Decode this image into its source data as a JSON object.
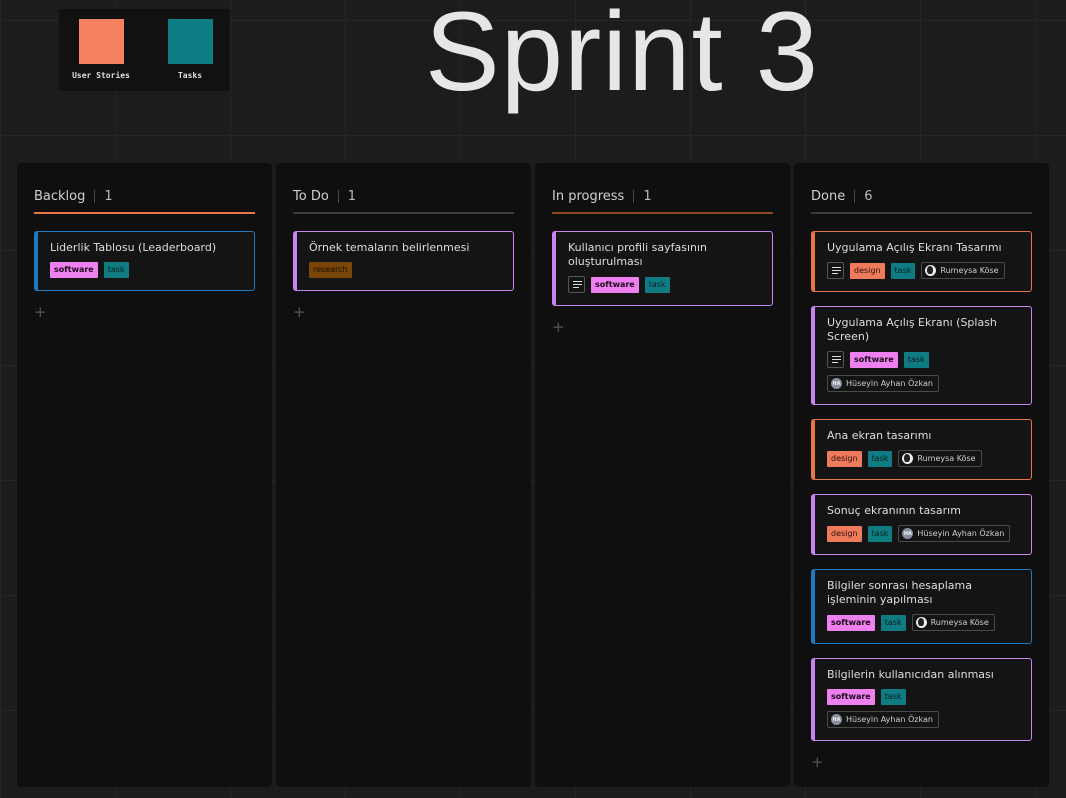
{
  "legend": [
    {
      "label": "User Stories",
      "color": "#f58160"
    },
    {
      "label": "Tasks",
      "color": "#0e7c83"
    }
  ],
  "title": "Sprint 3",
  "colors": {
    "software": "#ef80ef",
    "task": "#0f7b82",
    "design": "#f07a5c",
    "research": "#7a4508",
    "blue": "#1d7ac2",
    "purple": "#c685f0",
    "orange": "#e8744a"
  },
  "columns": [
    {
      "name": "Backlog",
      "count": "1",
      "rule_color": "#e8744a",
      "cards": [
        {
          "title": "Liderlik Tablosu (Leaderboard)",
          "border": "#1d7ac2",
          "note": false,
          "tags": [
            {
              "label": "software",
              "kind": "software"
            },
            {
              "label": "task",
              "kind": "task"
            }
          ],
          "assignee": null
        }
      ]
    },
    {
      "name": "To Do",
      "count": "1",
      "rule_color": "#3c3c3c",
      "cards": [
        {
          "title": "Örnek temaların belirlenmesi",
          "border": "#c685f0",
          "note": false,
          "tags": [
            {
              "label": "research",
              "kind": "research"
            }
          ],
          "assignee": null
        }
      ]
    },
    {
      "name": "In progress",
      "count": "1",
      "rule_color": "#8a4a1e",
      "cards": [
        {
          "title": "Kullanıcı profili sayfasının oluşturulması",
          "border": "#c685f0",
          "note": true,
          "tags": [
            {
              "label": "software",
              "kind": "software"
            },
            {
              "label": "task",
              "kind": "task"
            }
          ],
          "assignee": null
        }
      ]
    },
    {
      "name": "Done",
      "count": "6",
      "rule_color": "#3c3c3c",
      "cards": [
        {
          "title": "Uygulama Açılış Ekranı Tasarımı",
          "border": "#e8744a",
          "note": true,
          "tags": [
            {
              "label": "design",
              "kind": "design"
            },
            {
              "label": "task",
              "kind": "task"
            }
          ],
          "assignee": {
            "name": "Rumeysa Köse",
            "avatar": "r"
          },
          "wrap_assignee": false
        },
        {
          "title": "Uygulama Açılış Ekranı (Splash Screen)",
          "border": "#c685f0",
          "note": true,
          "tags": [
            {
              "label": "software",
              "kind": "software"
            },
            {
              "label": "task",
              "kind": "task"
            }
          ],
          "assignee": {
            "name": "Hüseyin Ayhan Özkan",
            "avatar": "h"
          },
          "wrap_assignee": true
        },
        {
          "title": "Ana ekran tasarımı",
          "border": "#e8744a",
          "note": false,
          "tags": [
            {
              "label": "design",
              "kind": "design"
            },
            {
              "label": "task",
              "kind": "task"
            }
          ],
          "assignee": {
            "name": "Rumeysa Köse",
            "avatar": "r"
          },
          "wrap_assignee": false
        },
        {
          "title": "Sonuç ekranının tasarım",
          "border": "#c685f0",
          "note": false,
          "tags": [
            {
              "label": "design",
              "kind": "design"
            },
            {
              "label": "task",
              "kind": "task"
            }
          ],
          "assignee": {
            "name": "Hüseyin Ayhan Özkan",
            "avatar": "h"
          },
          "wrap_assignee": false
        },
        {
          "title": "Bilgiler sonrası hesaplama işleminin yapılması",
          "border": "#1d7ac2",
          "note": false,
          "tags": [
            {
              "label": "software",
              "kind": "software"
            },
            {
              "label": "task",
              "kind": "task"
            }
          ],
          "assignee": {
            "name": "Rumeysa Köse",
            "avatar": "r"
          },
          "wrap_assignee": false
        },
        {
          "title": "Bilgilerin kullanıcıdan alınması",
          "border": "#c685f0",
          "note": false,
          "tags": [
            {
              "label": "software",
              "kind": "software"
            },
            {
              "label": "task",
              "kind": "task"
            }
          ],
          "assignee": {
            "name": "Hüseyin Ayhan Özkan",
            "avatar": "h"
          },
          "wrap_assignee": false
        }
      ]
    }
  ],
  "add_label": "+"
}
